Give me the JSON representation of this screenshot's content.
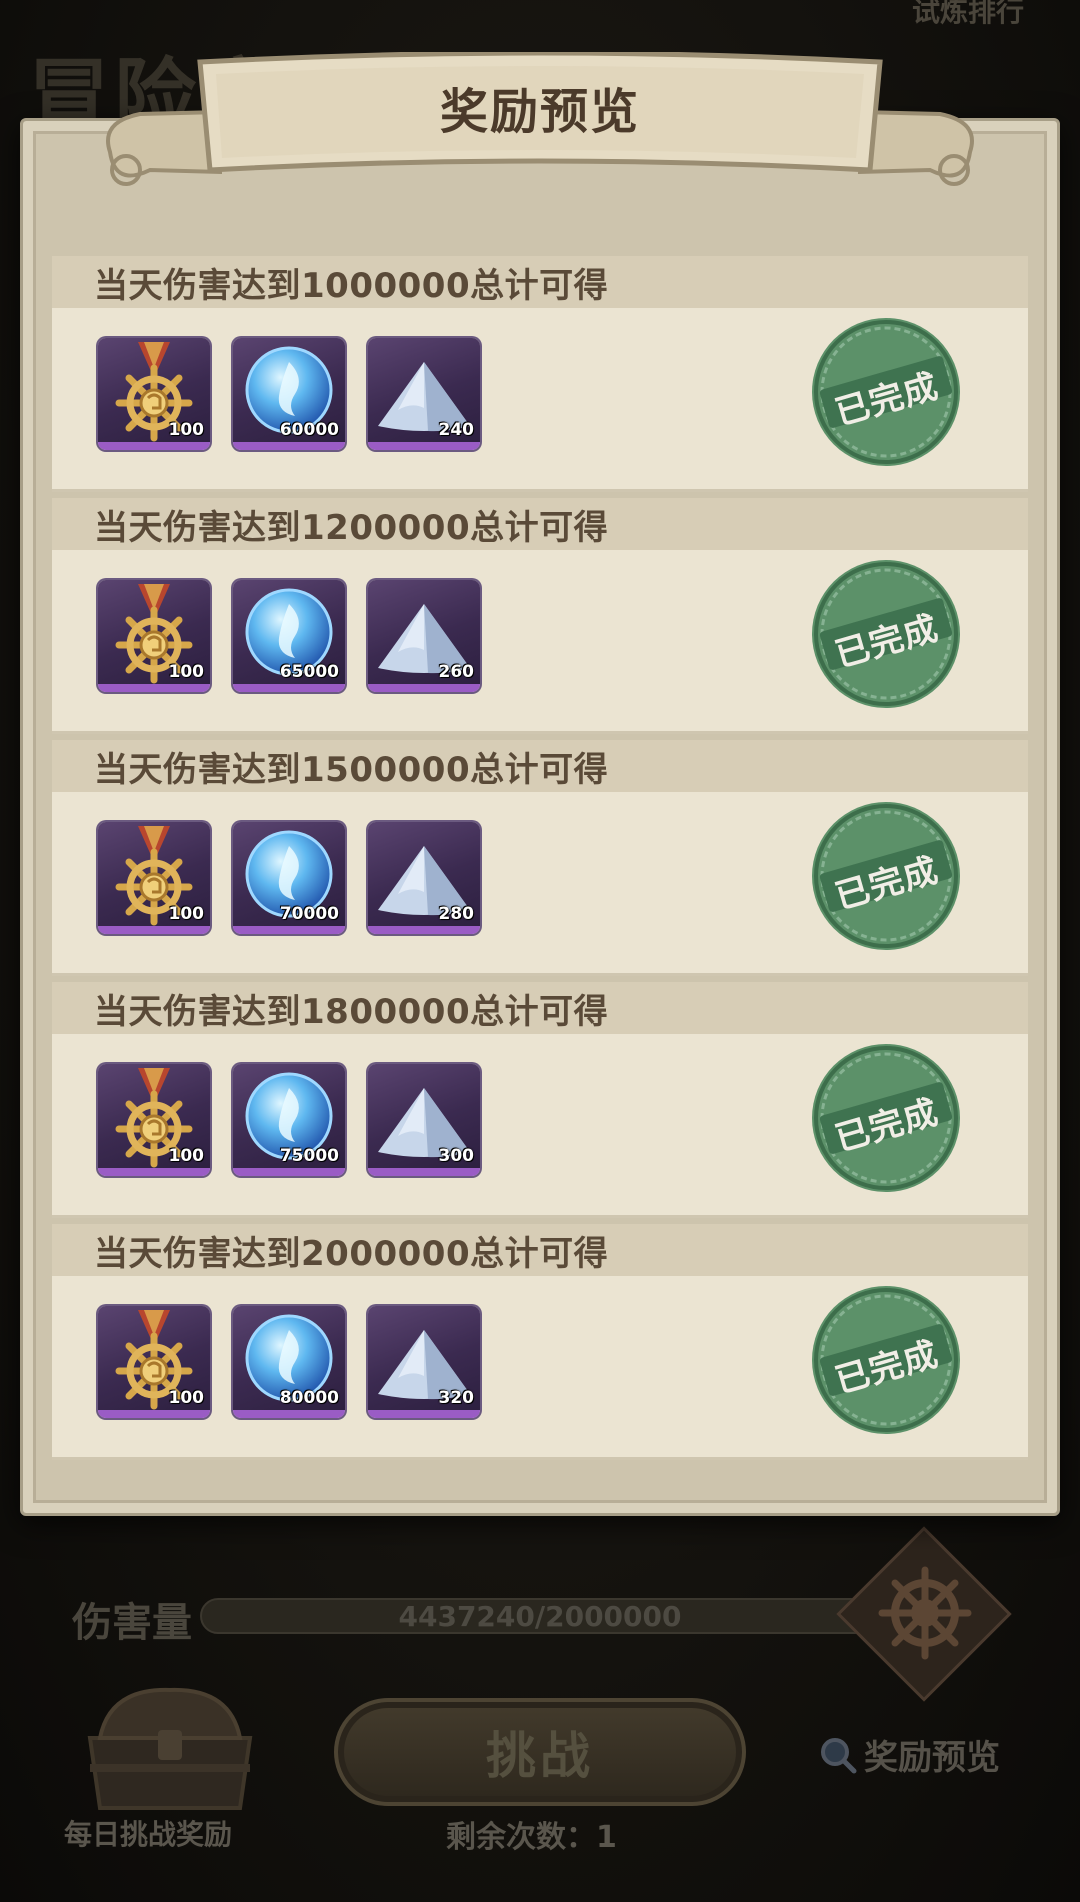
{
  "background": {
    "title": "冒险家",
    "ranking_label": "试炼排行",
    "damage_label": "伤害量",
    "damage_value": "4437240/2000000",
    "daily_reward_label": "每日挑战奖励",
    "challenge_button": "挑战",
    "remaining_attempts": "剩余次数：1",
    "preview_link": "奖励预览"
  },
  "modal": {
    "title": "奖励预览",
    "rows": [
      {
        "label": "当天伤害达到1000000总计可得",
        "items": [
          {
            "icon": "helm-medal-icon",
            "qty": "100"
          },
          {
            "icon": "blue-orb-icon",
            "qty": "60000"
          },
          {
            "icon": "dust-pile-icon",
            "qty": "240"
          }
        ],
        "status": "已完成"
      },
      {
        "label": "当天伤害达到1200000总计可得",
        "items": [
          {
            "icon": "helm-medal-icon",
            "qty": "100"
          },
          {
            "icon": "blue-orb-icon",
            "qty": "65000"
          },
          {
            "icon": "dust-pile-icon",
            "qty": "260"
          }
        ],
        "status": "已完成"
      },
      {
        "label": "当天伤害达到1500000总计可得",
        "items": [
          {
            "icon": "helm-medal-icon",
            "qty": "100"
          },
          {
            "icon": "blue-orb-icon",
            "qty": "70000"
          },
          {
            "icon": "dust-pile-icon",
            "qty": "280"
          }
        ],
        "status": "已完成"
      },
      {
        "label": "当天伤害达到1800000总计可得",
        "items": [
          {
            "icon": "helm-medal-icon",
            "qty": "100"
          },
          {
            "icon": "blue-orb-icon",
            "qty": "75000"
          },
          {
            "icon": "dust-pile-icon",
            "qty": "300"
          }
        ],
        "status": "已完成"
      },
      {
        "label": "当天伤害达到2000000总计可得",
        "items": [
          {
            "icon": "helm-medal-icon",
            "qty": "100"
          },
          {
            "icon": "blue-orb-icon",
            "qty": "80000"
          },
          {
            "icon": "dust-pile-icon",
            "qty": "320"
          }
        ],
        "status": "已完成"
      }
    ]
  },
  "colors": {
    "stamp_green": "#4f8a5f",
    "item_rarity_purple": "#9a5cc5",
    "header_text": "#5a4a38"
  }
}
